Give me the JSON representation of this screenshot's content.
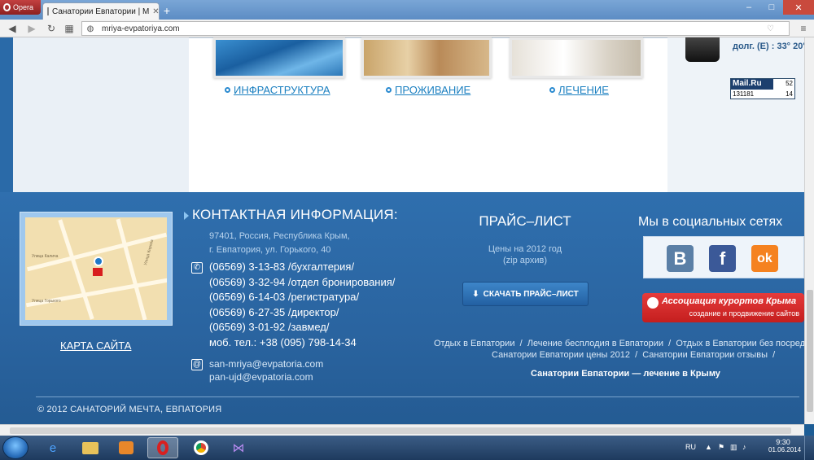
{
  "browser": {
    "menu_label": "Opera",
    "tab_title": "Санатории Евпатории | М",
    "url": "mriya-evpatoriya.com",
    "window_controls": [
      "–",
      "□",
      "✕"
    ]
  },
  "page": {
    "categories": [
      {
        "label": "ИНФРАСТРУКТУРА"
      },
      {
        "label": "ПРОЖИВАНИЕ"
      },
      {
        "label": "ЛЕЧЕНИЕ"
      }
    ],
    "weather_text": "долг. (E) : 33° 20'",
    "counter": {
      "brand": "Mail.Ru",
      "total": "131181",
      "top": "52",
      "bottom": "14"
    }
  },
  "footer": {
    "map_title": "",
    "sitemap_link": "КАРТА САЙТА",
    "map_streets": [
      "Улица Калича",
      "Улица Горького",
      "Улица Кирова"
    ],
    "contact": {
      "title": "КОНТАКТНАЯ ИНФОРМАЦИЯ:",
      "address_line1": "97401, Россия, Республика Крым,",
      "address_line2": "г. Евпатория, ул. Горького, 40",
      "phones": [
        "(06569) 3-13-83 /бухгалтерия/",
        "(06569) 3-32-94 /отдел бронирования/",
        "(06569) 6-14-03 /регистратура/",
        "(06569) 6-27-35 /директор/",
        "(06569) 3-01-92 /завмед/",
        "моб. тел.: +38 (095) 798-14-34"
      ],
      "emails": [
        "san-mriya@evpatoria.com",
        "pan-ujd@evpatoria.com"
      ]
    },
    "price": {
      "title": "ПРАЙС–ЛИСТ",
      "subtitle1": "Цены на 2012 год",
      "subtitle2": "(zip архив)",
      "download_label": "СКАЧАТЬ ПРАЙС–ЛИСТ"
    },
    "social": {
      "title": "Мы в социальных сетях",
      "networks": [
        {
          "name": "vk",
          "letter": "B",
          "color": "#5a7fa6"
        },
        {
          "name": "facebook",
          "letter": "f",
          "color": "#3b5998"
        },
        {
          "name": "odnoklassniki",
          "letter": "ok",
          "color": "#f58220"
        }
      ]
    },
    "association": {
      "title": "Ассоциация курортов Крыма",
      "subtitle": "создание и продвижение сайтов"
    },
    "seo_links_row1": [
      "Отдых в Евпатории",
      "Лечение бесплодия в Евпатории",
      "Отдых в Евпатории без посредников"
    ],
    "seo_links_row2": [
      "Санатории Евпатории цены 2012",
      "Санатории Евпатории отзывы"
    ],
    "slogan": "Санатории Евпатории — лечение в Крыму",
    "copyright": "© 2012 САНАТОРИЙ МЕЧТА, ЕВПАТОРИЯ"
  },
  "taskbar": {
    "language": "RU",
    "time": "9:30",
    "date": "01.06.2014"
  },
  "colors": {
    "footer_bg": "#2a64a0",
    "link_blue": "#1a7fc0",
    "accent_red": "#c41e1e"
  }
}
